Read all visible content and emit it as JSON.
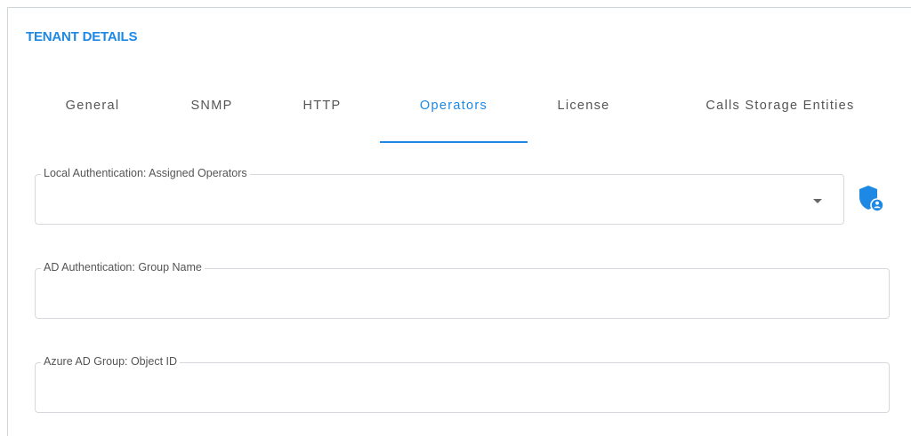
{
  "header": {
    "title": "TENANT DETAILS"
  },
  "tabs": [
    {
      "label": "General",
      "active": false
    },
    {
      "label": "SNMP",
      "active": false
    },
    {
      "label": "HTTP",
      "active": false
    },
    {
      "label": "Operators",
      "active": true
    },
    {
      "label": "License",
      "active": false
    },
    {
      "label": "Calls Storage Entities",
      "active": false
    }
  ],
  "fields": {
    "local_auth": {
      "label": "Local Authentication: Assigned Operators",
      "value": ""
    },
    "ad_group": {
      "label": "AD Authentication: Group Name",
      "value": ""
    },
    "azure_group": {
      "label": "Azure AD Group: Object ID",
      "value": ""
    }
  },
  "icons": {
    "dropdown": "chevron-down-icon",
    "shield": "shield-user-icon"
  },
  "colors": {
    "accent": "#1e88e5",
    "text": "#555555",
    "border": "#d5d8dc"
  }
}
